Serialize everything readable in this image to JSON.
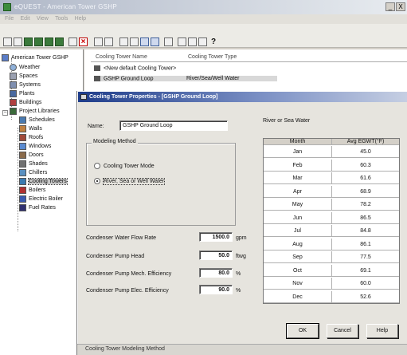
{
  "window": {
    "title": "eQUEST - American Tower GSHP",
    "min": "_",
    "close": "X"
  },
  "menu": [
    "File",
    "Edit",
    "View",
    "Tools",
    "Help"
  ],
  "tree": {
    "root": "American Tower GSHP",
    "items": [
      "Weather",
      "Spaces",
      "Systems",
      "Plants",
      "Buildings",
      "Project Libraries"
    ],
    "library": [
      "Schedules",
      "Walls",
      "Roofs",
      "Windows",
      "Doors",
      "Shades",
      "Chillers",
      "Cooling Towers",
      "Boilers",
      "Electric Boiler",
      "Fuel Rates"
    ]
  },
  "list": {
    "col_name": "Cooling Tower Name",
    "col_type": "Cooling Tower Type",
    "rows": [
      {
        "name": "<New default Cooling Tower>",
        "type": ""
      },
      {
        "name": "GSHP Ground Loop",
        "type": "River/Sea/Well Water"
      }
    ]
  },
  "dialog": {
    "title": "Cooling Tower Properties - [GSHP Ground Loop]",
    "name_label": "Name:",
    "name_value": "GSHP Ground Loop",
    "method_group": "Modeling Method",
    "radio_cooling": "Cooling Tower Mode",
    "radio_river": "River, Sea or Well Water",
    "water_group": "River or Sea Water",
    "table_head_month": "Month",
    "table_head_temp": "Avg EGWT(°F)",
    "months": [
      {
        "month": "Jan",
        "temp": "45.0"
      },
      {
        "month": "Feb",
        "temp": "60.3"
      },
      {
        "month": "Mar",
        "temp": "61.6"
      },
      {
        "month": "Apr",
        "temp": "68.9"
      },
      {
        "month": "May",
        "temp": "78.2"
      },
      {
        "month": "Jun",
        "temp": "86.5"
      },
      {
        "month": "Jul",
        "temp": "84.8"
      },
      {
        "month": "Aug",
        "temp": "86.1"
      },
      {
        "month": "Sep",
        "temp": "77.5"
      },
      {
        "month": "Oct",
        "temp": "69.1"
      },
      {
        "month": "Nov",
        "temp": "60.0"
      },
      {
        "month": "Dec",
        "temp": "52.6"
      }
    ],
    "fields": [
      {
        "label": "Condenser Water Flow Rate",
        "value": "1500.0",
        "unit": "gpm"
      },
      {
        "label": "Condenser Pump Head",
        "value": "50.0",
        "unit": "ftwg"
      },
      {
        "label": "Condenser Pump Mech. Efficiency",
        "value": "80.0",
        "unit": "%"
      },
      {
        "label": "Condenser Pump Elec. Efficiency",
        "value": "90.0",
        "unit": "%"
      }
    ],
    "ok": "OK",
    "cancel": "Cancel",
    "help": "Help"
  },
  "status": "Cooling Tower Modeling Method",
  "colors": {
    "dialog_title": "#1e3c8a",
    "window_face": "#d4d0c8"
  }
}
